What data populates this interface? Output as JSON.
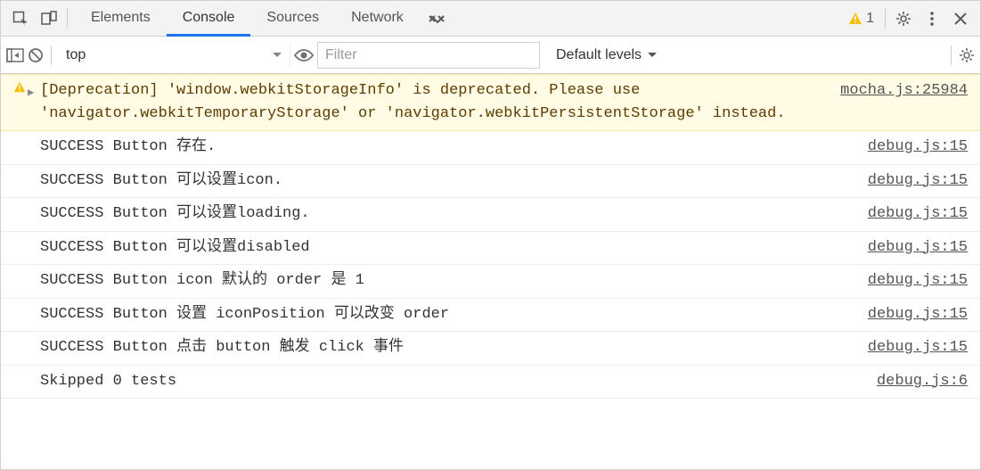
{
  "toolbar": {
    "tabs": [
      "Elements",
      "Console",
      "Sources",
      "Network"
    ],
    "active_tab_index": 1,
    "warning_count": "1"
  },
  "subbar": {
    "context": "top",
    "filter_placeholder": "Filter",
    "levels_label": "Default levels"
  },
  "logs": [
    {
      "type": "warn",
      "expand": true,
      "message": "[Deprecation] 'window.webkitStorageInfo' is deprecated. Please use 'navigator.webkitTemporaryStorage' or 'navigator.webkitPersistentStorage' instead.",
      "source": "mocha.js:25984"
    },
    {
      "type": "plain",
      "message": "SUCCESS Button 存在.",
      "source": "debug.js:15"
    },
    {
      "type": "plain",
      "message": "SUCCESS Button 可以设置icon.",
      "source": "debug.js:15"
    },
    {
      "type": "plain",
      "message": "SUCCESS Button 可以设置loading.",
      "source": "debug.js:15"
    },
    {
      "type": "plain",
      "message": "SUCCESS Button 可以设置disabled",
      "source": "debug.js:15"
    },
    {
      "type": "plain",
      "message": "SUCCESS Button icon 默认的 order 是 1",
      "source": "debug.js:15"
    },
    {
      "type": "plain",
      "message": "SUCCESS Button 设置 iconPosition 可以改变 order",
      "source": "debug.js:15"
    },
    {
      "type": "plain",
      "message": "SUCCESS Button 点击 button 触发 click 事件",
      "source": "debug.js:15"
    },
    {
      "type": "plain",
      "message": "Skipped 0 tests",
      "source": "debug.js:6"
    }
  ]
}
